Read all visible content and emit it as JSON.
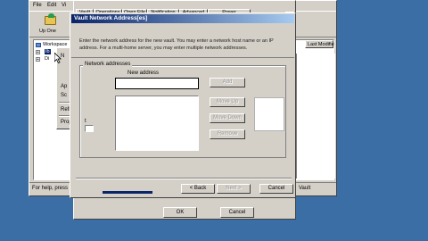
{
  "menu": {
    "file": "File",
    "edit": "Edit",
    "view": "Vi"
  },
  "toolbar": {
    "up_one": "Up One"
  },
  "tree": {
    "workspace": "Workspace",
    "item1": "Ib",
    "item2": "Di"
  },
  "context_menu": [
    "N",
    "Ap",
    "Sc",
    "Refre",
    "Prope"
  ],
  "list": {
    "last_modified_header": "Last Modifie"
  },
  "status": {
    "left": "For help, press",
    "right": "Vault"
  },
  "props_tabs": [
    "Vault",
    "Operations",
    "Open File",
    "Notification",
    "Advanced",
    "Power Management"
  ],
  "props_buttons": {
    "ok": "OK",
    "cancel": "Cancel"
  },
  "dialog": {
    "title": "Vault Network Address[es]",
    "close_glyph": "×",
    "description": "Enter the network address for the new vault. You may enter a network host name or an IP address. For a multi-home server, you may enter multiple network addresses.",
    "group_label": "Network addresses",
    "new_address_label": "New address",
    "new_address_value": "",
    "buttons": {
      "add": "Add",
      "move_up": "Move Up",
      "move_down": "Move Down",
      "remove": "Remove",
      "back": "< Back",
      "next": "Next >",
      "cancel": "Cancel"
    },
    "side_label": "t"
  }
}
